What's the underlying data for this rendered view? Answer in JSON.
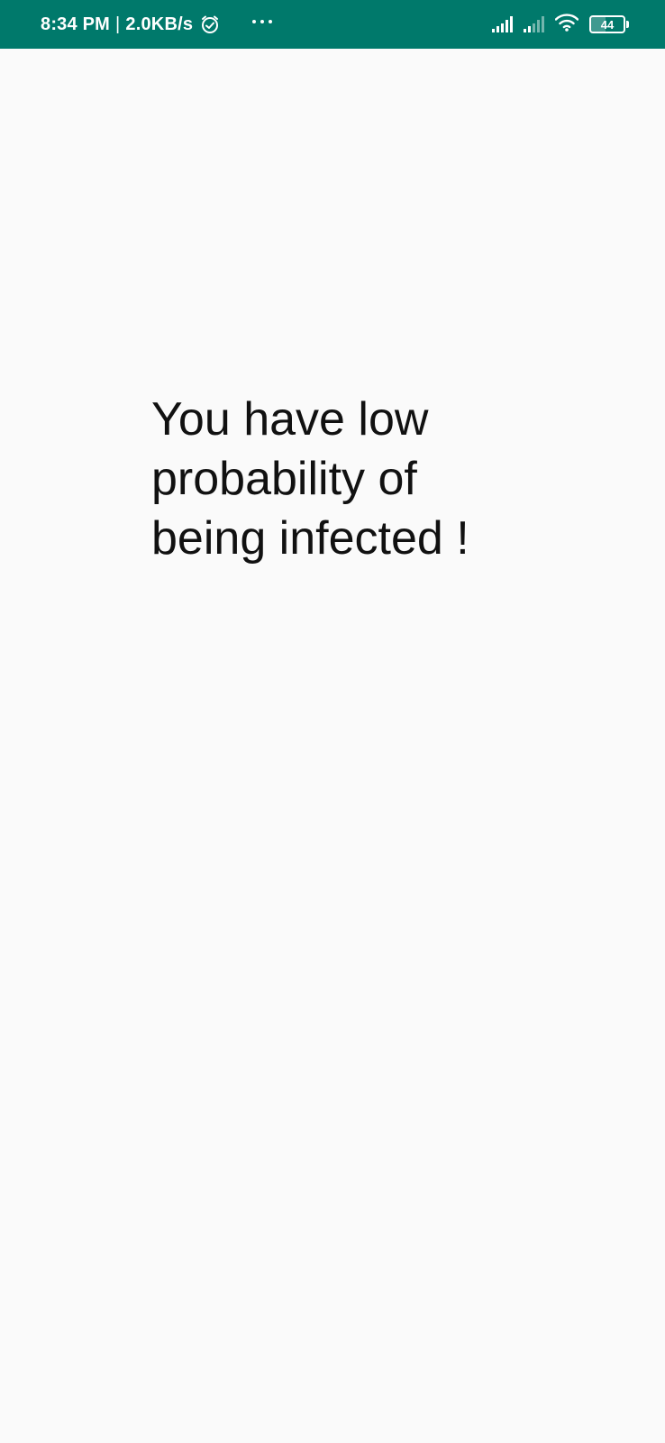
{
  "status_bar": {
    "time": "8:34 PM",
    "separator": "|",
    "network_speed": "2.0KB/s",
    "alarm_icon": "alarm-clock-icon",
    "more_icon": "more-horizontal-icon",
    "signal_1_icon": "cellular-signal-icon",
    "signal_2_icon": "cellular-signal-icon",
    "wifi_icon": "wifi-icon",
    "battery_level": "44",
    "battery_fraction": 0.44,
    "background_color": "#00796b",
    "text_color": "#ffffff"
  },
  "main": {
    "message": "You have low probability of being infected !",
    "background_color": "#fafafa",
    "text_color": "#111111"
  }
}
